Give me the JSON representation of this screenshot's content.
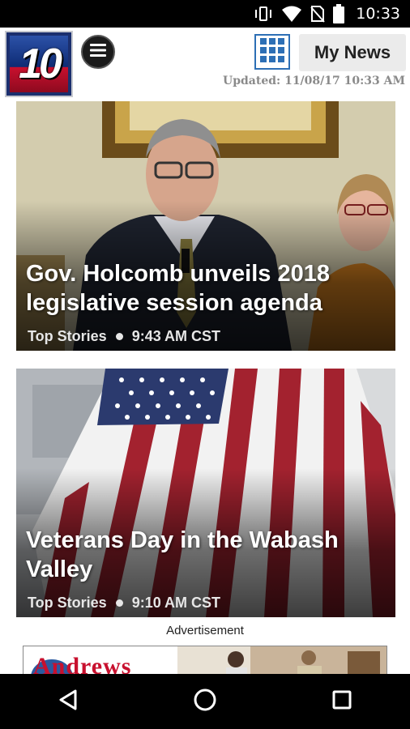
{
  "status_bar": {
    "time": "10:33",
    "icons": [
      "vibrate-icon",
      "wifi-icon",
      "no-sim-icon",
      "battery-icon"
    ]
  },
  "header": {
    "logo_text": "10",
    "menu_icon": "menu-icon",
    "grid_icon": "grid-icon",
    "my_news_label": "My News",
    "updated_text": "Updated: 11/08/17 10:33 AM"
  },
  "stories": [
    {
      "headline": "Gov. Holcomb unveils 2018 legislative session agenda",
      "category": "Top Stories",
      "time": "9:43 AM CST"
    },
    {
      "headline": "Veterans Day in the Wabash Valley",
      "category": "Top Stories",
      "time": "9:10 AM CST"
    }
  ],
  "ad": {
    "label": "Advertisement",
    "banner_text": "Andrews"
  },
  "nav": {
    "icons": [
      "back-icon",
      "home-icon",
      "recents-icon"
    ]
  },
  "colors": {
    "accent": "#2d6fb5",
    "logo_blue": "#1b2f6e",
    "logo_red": "#c8102e"
  }
}
